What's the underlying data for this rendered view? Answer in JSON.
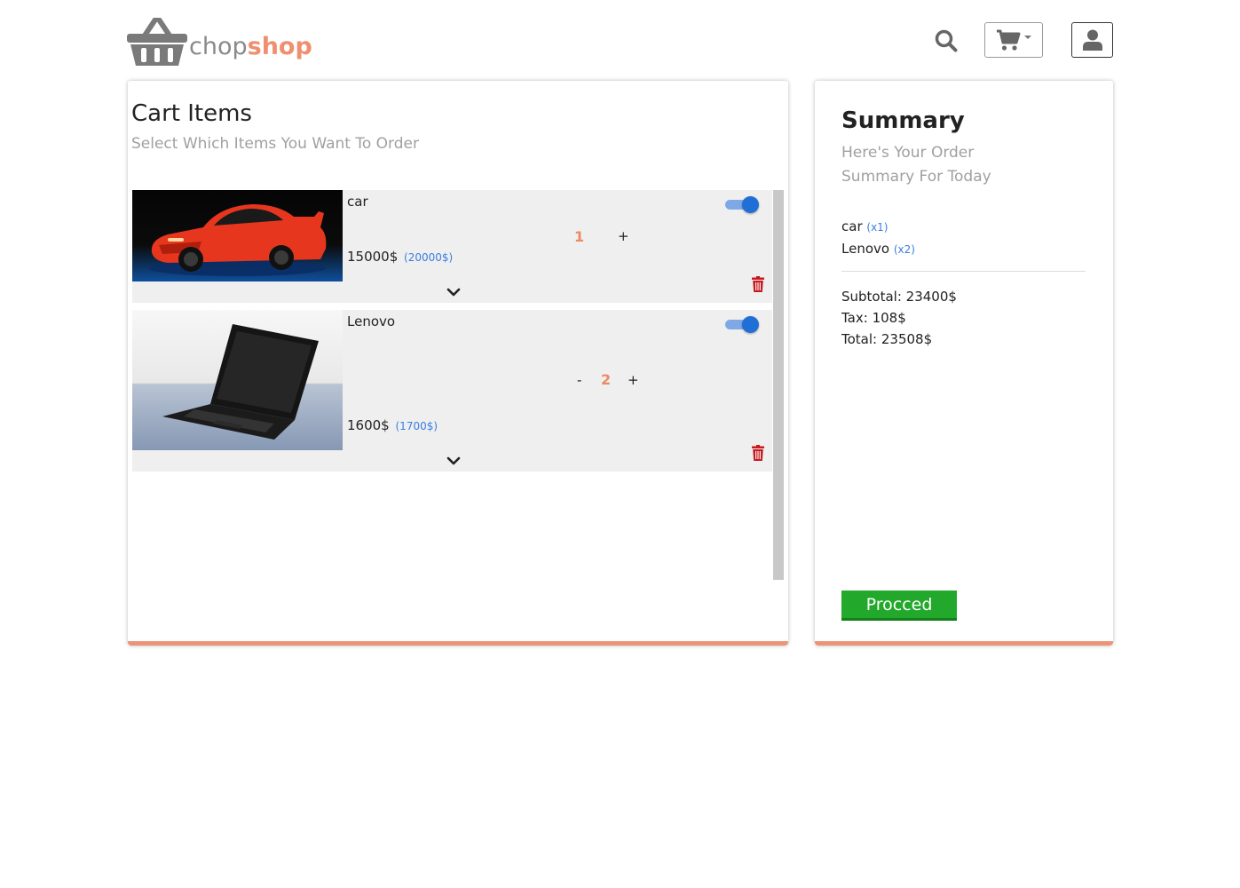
{
  "brand": {
    "part1": "chop",
    "part2": "shop",
    "accent_color": "#ef8f70"
  },
  "header": {
    "search_icon": "search-icon",
    "cart_icon": "shopping-cart-icon",
    "user_icon": "user-icon"
  },
  "cart": {
    "title": "Cart Items",
    "subtitle": "Select Which Items You Want To Order",
    "items": [
      {
        "name": "car",
        "price": "15000$",
        "old_price": "(20000$)",
        "quantity": "1",
        "minus": "",
        "plus": "+",
        "selected": true,
        "image": "red-sports-car"
      },
      {
        "name": "Lenovo",
        "price": "1600$",
        "old_price": "(1700$)",
        "quantity": "2",
        "minus": "-",
        "plus": "+",
        "selected": true,
        "image": "black-laptop"
      }
    ]
  },
  "summary": {
    "title": "Summary",
    "subtitle": "Here's Your Order Summary For Today",
    "lines": [
      {
        "name": "car",
        "qty": "(x1)"
      },
      {
        "name": "Lenovo",
        "qty": "(x2)"
      }
    ],
    "subtotal": "Subtotal: 23400$",
    "tax": "Tax: 108$",
    "total": "Total: 23508$",
    "proceed_label": "Procced",
    "proceed_color": "#22a82a"
  }
}
